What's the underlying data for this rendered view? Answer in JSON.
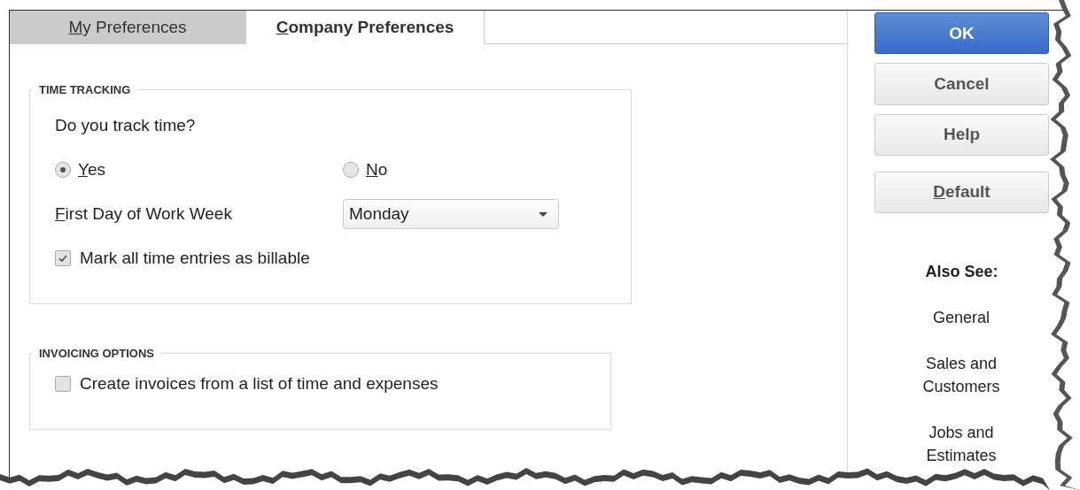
{
  "tabs": [
    {
      "label": "My Preferences",
      "selected": false,
      "underline_first": true
    },
    {
      "label": "Company Preferences",
      "selected": true,
      "underline_first": true
    }
  ],
  "sections": [
    {
      "title": "TIME TRACKING",
      "rows": [
        {
          "kind": "question",
          "text": "Do you track time?"
        },
        {
          "kind": "radio_group",
          "options": [
            {
              "label": "Yes",
              "selected": true,
              "underline_first": true
            },
            {
              "label": "No",
              "selected": false,
              "underline_first": true
            }
          ]
        },
        {
          "kind": "dropdown",
          "label": "First Day of Work Week",
          "underline_first": true,
          "value": "Monday"
        },
        {
          "kind": "checkbox",
          "label": "Mark all time entries as billable",
          "checked": true
        }
      ]
    },
    {
      "title": "INVOICING OPTIONS",
      "rows": [
        {
          "kind": "checkbox",
          "label": "Create invoices from a list of time and expenses",
          "checked": false
        }
      ]
    }
  ],
  "buttons": [
    {
      "label": "OK",
      "primary": true,
      "underline_first": false
    },
    {
      "label": "Cancel",
      "primary": false,
      "underline_first": false
    },
    {
      "label": "Help",
      "primary": false,
      "underline_first": false
    },
    {
      "label": "Default",
      "primary": false,
      "underline_first": true
    }
  ],
  "also_see": {
    "title": "Also See:",
    "links": [
      "General",
      "Sales and Customers",
      "Jobs and Estimates"
    ]
  }
}
